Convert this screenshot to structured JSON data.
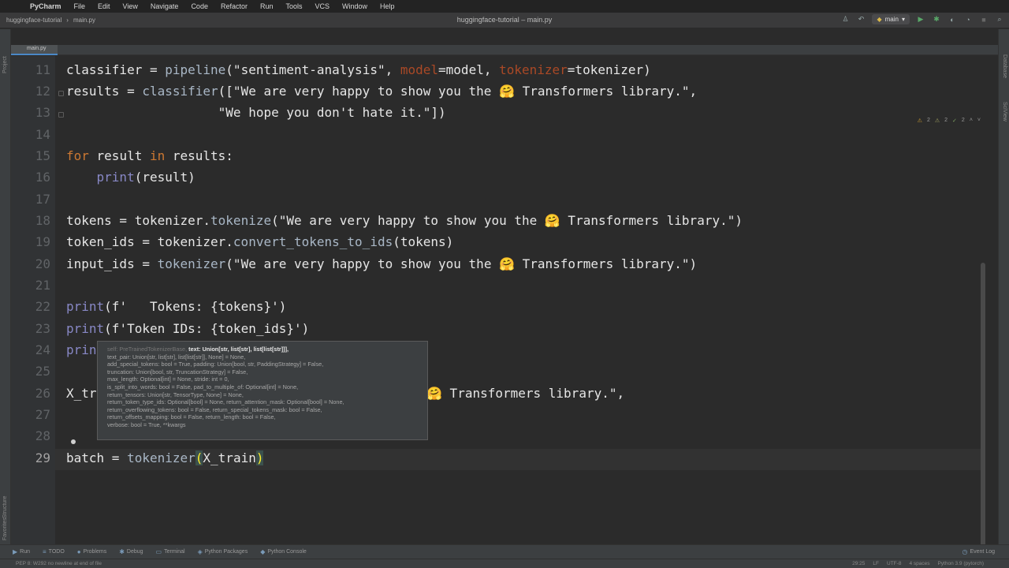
{
  "menubar": {
    "app": "PyCharm",
    "items": [
      "File",
      "Edit",
      "View",
      "Navigate",
      "Code",
      "Refactor",
      "Run",
      "Tools",
      "VCS",
      "Window",
      "Help"
    ]
  },
  "window": {
    "title": "huggingface-tutorial – main.py",
    "breadcrumb_project": "huggingface-tutorial",
    "breadcrumb_file": "main.py",
    "run_config": "main"
  },
  "tab": {
    "label": "main.py"
  },
  "left_strip": {
    "project": "Project",
    "structure": "Structure",
    "favorites": "Favorites"
  },
  "right_strip": {
    "database": "Database",
    "sciview": "SciView"
  },
  "inspections": {
    "warnings": "2",
    "weak_warnings": "2",
    "typos": "2"
  },
  "code_lines": [
    {
      "n": "11"
    },
    {
      "n": "12"
    },
    {
      "n": "13"
    },
    {
      "n": "14"
    },
    {
      "n": "15"
    },
    {
      "n": "16"
    },
    {
      "n": "17"
    },
    {
      "n": "18"
    },
    {
      "n": "19"
    },
    {
      "n": "20"
    },
    {
      "n": "21"
    },
    {
      "n": "22"
    },
    {
      "n": "23"
    },
    {
      "n": "24"
    },
    {
      "n": "25"
    },
    {
      "n": "26"
    },
    {
      "n": "27"
    },
    {
      "n": "28"
    },
    {
      "n": "29"
    }
  ],
  "code": {
    "l11_a": "classifier = ",
    "l11_b": "pipeline",
    "l11_c": "(\"sentiment-analysis\", ",
    "l11_d": "model",
    "l11_e": "=model, ",
    "l11_f": "tokenizer",
    "l11_g": "=tokenizer)",
    "l12_a": "results = ",
    "l12_b": "classifier",
    "l12_c": "([\"We are very happy to show you the 🤗 Transformers library.\",",
    "l13": "                    \"We hope you don't hate it.\"])",
    "l15_a": "for",
    "l15_b": " result ",
    "l15_c": "in",
    "l15_d": " results:",
    "l16_a": "    ",
    "l16_b": "print",
    "l16_c": "(result)",
    "l18_a": "tokens = tokenizer.",
    "l18_b": "tokenize",
    "l18_c": "(\"We are very happy to show you the 🤗 Transformers library.\")",
    "l19_a": "token_ids = tokenizer.",
    "l19_b": "convert_tokens_to_ids",
    "l19_c": "(tokens)",
    "l20_a": "input_ids = ",
    "l20_b": "tokenizer",
    "l20_c": "(\"We are very happy to show you the 🤗 Transformers library.\")",
    "l22_a": "print",
    "l22_b": "(f'   Tokens: ",
    "l22_c": "{tokens}",
    "l22_d": "')",
    "l23_a": "print",
    "l23_b": "(f'Token IDs: ",
    "l23_c": "{token_ids}",
    "l23_d": "')",
    "l24": "prin",
    "l26_a": "X_tr",
    "l26_b": "🤗 Transformers library.\",",
    "l29_a": "batch = ",
    "l29_b": "tokenizer",
    "l29_c": "(",
    "l29_d": "X_train",
    "l29_e": ")"
  },
  "param_info": {
    "self": "self: PreTrainedTokenizerBase,",
    "current": "text: Union[str, list[str], list[list[str]]],",
    "lines": [
      "text_pair: Union[str, list[str], list[list[str]], None] = None,",
      "add_special_tokens: bool = True, padding: Union[bool, str, PaddingStrategy] = False,",
      "truncation: Union[bool, str, TruncationStrategy] = False,",
      "max_length: Optional[int] = None, stride: int = 0,",
      "is_split_into_words: bool = False, pad_to_multiple_of: Optional[int] = None,",
      "return_tensors: Union[str, TensorType, None] = None,",
      "return_token_type_ids: Optional[bool] = None, return_attention_mask: Optional[bool] = None,",
      "return_overflowing_tokens: bool = False, return_special_tokens_mask: bool = False,",
      "return_offsets_mapping: bool = False, return_length: bool = False,",
      "verbose: bool = True, **kwargs"
    ]
  },
  "bottom_tools": [
    "Run",
    "TODO",
    "Problems",
    "Debug",
    "Terminal",
    "Python Packages",
    "Python Console"
  ],
  "event_log": "Event Log",
  "status": {
    "message": "PEP 8: W292 no newline at end of file",
    "position": "29:25",
    "line_sep": "LF",
    "encoding": "UTF-8",
    "indent": "4 spaces",
    "interpreter": "Python 3.9 (pytorch)"
  }
}
